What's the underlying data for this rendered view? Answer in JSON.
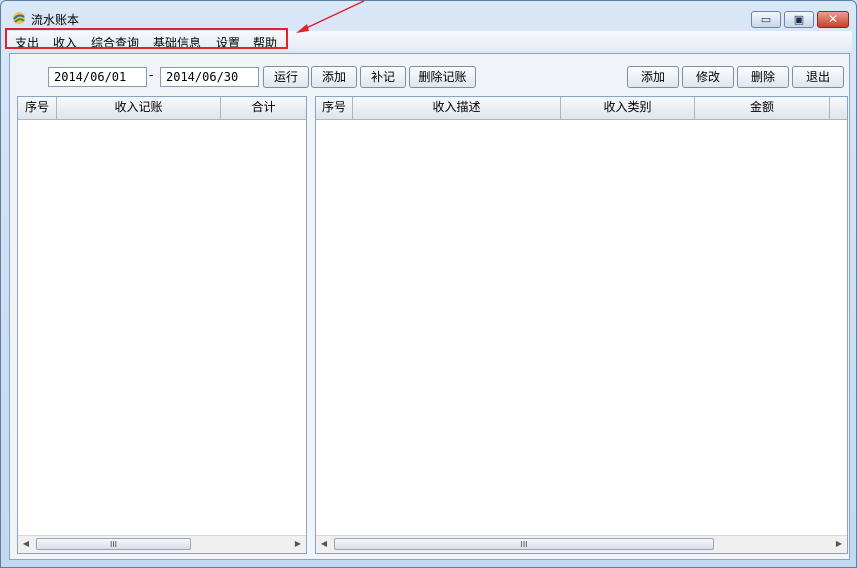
{
  "window": {
    "title": "流水账本",
    "minimize_icon": "minimize-icon",
    "maximize_icon": "maximize-icon",
    "close_icon": "close-icon",
    "minimize_glyph": "▭",
    "maximize_glyph": "▣",
    "close_glyph": "✕"
  },
  "menu": {
    "items": [
      "支出",
      "收入",
      "综合查询",
      "基础信息",
      "设置",
      "帮助"
    ]
  },
  "toolbar": {
    "start_date": "2014/06/01",
    "separator": "-",
    "end_date": "2014/06/30",
    "run_label": "运行",
    "add_label": "添加",
    "supplement_label": "补记",
    "delete_record_label": "删除记账",
    "right_add_label": "添加",
    "edit_label": "修改",
    "delete_label": "删除",
    "exit_label": "退出"
  },
  "left_grid": {
    "columns": [
      "序号",
      "收入记账",
      "合计"
    ],
    "rows": [],
    "scroll_grip": "III"
  },
  "right_grid": {
    "columns": [
      "序号",
      "收入描述",
      "收入类别",
      "金额"
    ],
    "rows": [],
    "scroll_grip": "III"
  },
  "scroll": {
    "left_arrow": "◀",
    "right_arrow": "▶"
  },
  "colors": {
    "annotation": "#e0222a",
    "frame": "#5c7fa6",
    "close_button": "#c7412a"
  }
}
